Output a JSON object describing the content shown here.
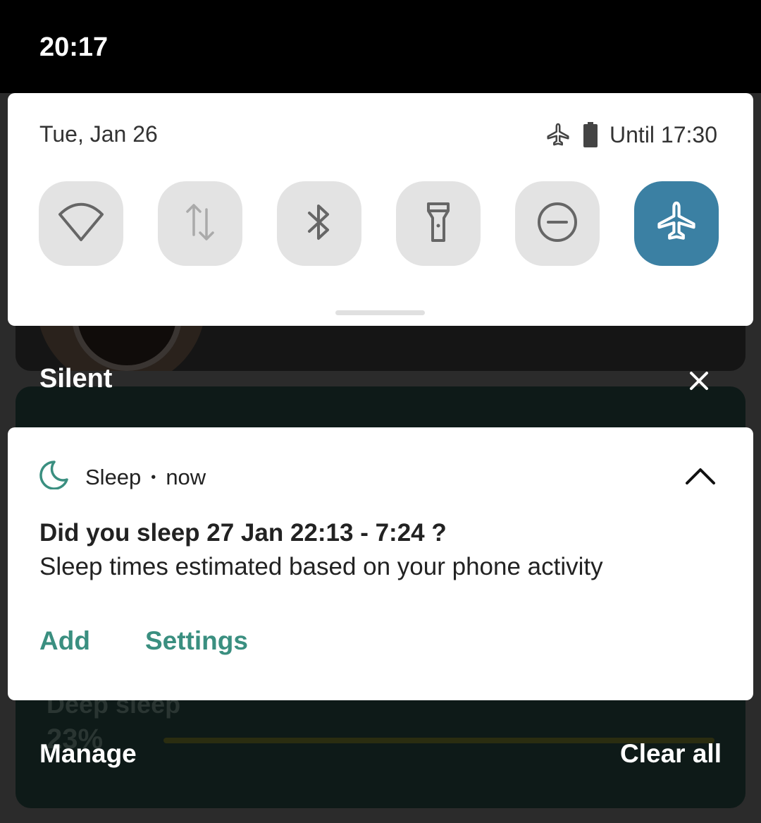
{
  "status_bar": {
    "time": "20:17"
  },
  "quick_settings": {
    "date": "Tue, Jan 26",
    "battery_text": "Until 17:30",
    "tiles": [
      {
        "icon": "wifi-icon",
        "active": false
      },
      {
        "icon": "mobile-data-icon",
        "active": false
      },
      {
        "icon": "bluetooth-icon",
        "active": false
      },
      {
        "icon": "flashlight-icon",
        "active": false
      },
      {
        "icon": "do-not-disturb-icon",
        "active": false
      },
      {
        "icon": "airplane-mode-icon",
        "active": true
      }
    ],
    "accent_active": "#3b80a3"
  },
  "background": {
    "ghost_label": "Deep sleep",
    "ghost_value": "23%"
  },
  "section": {
    "title": "Silent"
  },
  "notification": {
    "app": "Sleep",
    "time": "now",
    "title": "Did you sleep 27 Jan 22:13 - 7:24 ?",
    "text": "Sleep times estimated based on your phone activity",
    "actions": [
      "Add",
      "Settings"
    ],
    "accent": "#3a8f80"
  },
  "footer": {
    "manage_label": "Manage",
    "clear_all_label": "Clear all"
  }
}
